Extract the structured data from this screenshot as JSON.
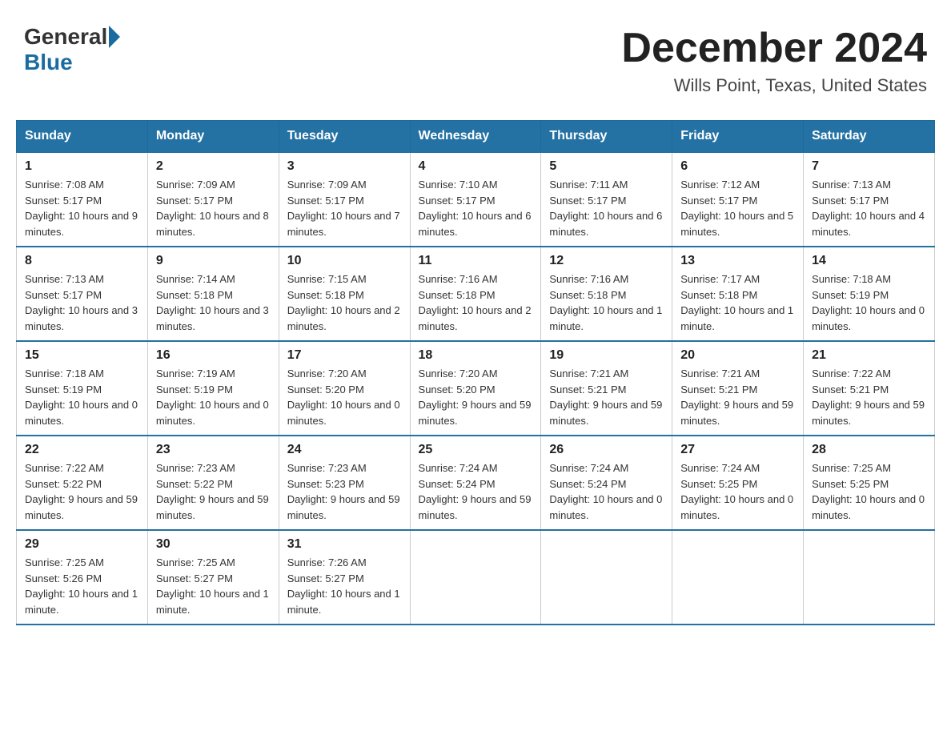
{
  "header": {
    "logo": {
      "general": "General",
      "blue": "Blue"
    },
    "title": "December 2024",
    "location": "Wills Point, Texas, United States"
  },
  "days_of_week": [
    "Sunday",
    "Monday",
    "Tuesday",
    "Wednesday",
    "Thursday",
    "Friday",
    "Saturday"
  ],
  "weeks": [
    [
      {
        "day": "1",
        "sunrise": "7:08 AM",
        "sunset": "5:17 PM",
        "daylight": "10 hours and 9 minutes."
      },
      {
        "day": "2",
        "sunrise": "7:09 AM",
        "sunset": "5:17 PM",
        "daylight": "10 hours and 8 minutes."
      },
      {
        "day": "3",
        "sunrise": "7:09 AM",
        "sunset": "5:17 PM",
        "daylight": "10 hours and 7 minutes."
      },
      {
        "day": "4",
        "sunrise": "7:10 AM",
        "sunset": "5:17 PM",
        "daylight": "10 hours and 6 minutes."
      },
      {
        "day": "5",
        "sunrise": "7:11 AM",
        "sunset": "5:17 PM",
        "daylight": "10 hours and 6 minutes."
      },
      {
        "day": "6",
        "sunrise": "7:12 AM",
        "sunset": "5:17 PM",
        "daylight": "10 hours and 5 minutes."
      },
      {
        "day": "7",
        "sunrise": "7:13 AM",
        "sunset": "5:17 PM",
        "daylight": "10 hours and 4 minutes."
      }
    ],
    [
      {
        "day": "8",
        "sunrise": "7:13 AM",
        "sunset": "5:17 PM",
        "daylight": "10 hours and 3 minutes."
      },
      {
        "day": "9",
        "sunrise": "7:14 AM",
        "sunset": "5:18 PM",
        "daylight": "10 hours and 3 minutes."
      },
      {
        "day": "10",
        "sunrise": "7:15 AM",
        "sunset": "5:18 PM",
        "daylight": "10 hours and 2 minutes."
      },
      {
        "day": "11",
        "sunrise": "7:16 AM",
        "sunset": "5:18 PM",
        "daylight": "10 hours and 2 minutes."
      },
      {
        "day": "12",
        "sunrise": "7:16 AM",
        "sunset": "5:18 PM",
        "daylight": "10 hours and 1 minute."
      },
      {
        "day": "13",
        "sunrise": "7:17 AM",
        "sunset": "5:18 PM",
        "daylight": "10 hours and 1 minute."
      },
      {
        "day": "14",
        "sunrise": "7:18 AM",
        "sunset": "5:19 PM",
        "daylight": "10 hours and 0 minutes."
      }
    ],
    [
      {
        "day": "15",
        "sunrise": "7:18 AM",
        "sunset": "5:19 PM",
        "daylight": "10 hours and 0 minutes."
      },
      {
        "day": "16",
        "sunrise": "7:19 AM",
        "sunset": "5:19 PM",
        "daylight": "10 hours and 0 minutes."
      },
      {
        "day": "17",
        "sunrise": "7:20 AM",
        "sunset": "5:20 PM",
        "daylight": "10 hours and 0 minutes."
      },
      {
        "day": "18",
        "sunrise": "7:20 AM",
        "sunset": "5:20 PM",
        "daylight": "9 hours and 59 minutes."
      },
      {
        "day": "19",
        "sunrise": "7:21 AM",
        "sunset": "5:21 PM",
        "daylight": "9 hours and 59 minutes."
      },
      {
        "day": "20",
        "sunrise": "7:21 AM",
        "sunset": "5:21 PM",
        "daylight": "9 hours and 59 minutes."
      },
      {
        "day": "21",
        "sunrise": "7:22 AM",
        "sunset": "5:21 PM",
        "daylight": "9 hours and 59 minutes."
      }
    ],
    [
      {
        "day": "22",
        "sunrise": "7:22 AM",
        "sunset": "5:22 PM",
        "daylight": "9 hours and 59 minutes."
      },
      {
        "day": "23",
        "sunrise": "7:23 AM",
        "sunset": "5:22 PM",
        "daylight": "9 hours and 59 minutes."
      },
      {
        "day": "24",
        "sunrise": "7:23 AM",
        "sunset": "5:23 PM",
        "daylight": "9 hours and 59 minutes."
      },
      {
        "day": "25",
        "sunrise": "7:24 AM",
        "sunset": "5:24 PM",
        "daylight": "9 hours and 59 minutes."
      },
      {
        "day": "26",
        "sunrise": "7:24 AM",
        "sunset": "5:24 PM",
        "daylight": "10 hours and 0 minutes."
      },
      {
        "day": "27",
        "sunrise": "7:24 AM",
        "sunset": "5:25 PM",
        "daylight": "10 hours and 0 minutes."
      },
      {
        "day": "28",
        "sunrise": "7:25 AM",
        "sunset": "5:25 PM",
        "daylight": "10 hours and 0 minutes."
      }
    ],
    [
      {
        "day": "29",
        "sunrise": "7:25 AM",
        "sunset": "5:26 PM",
        "daylight": "10 hours and 1 minute."
      },
      {
        "day": "30",
        "sunrise": "7:25 AM",
        "sunset": "5:27 PM",
        "daylight": "10 hours and 1 minute."
      },
      {
        "day": "31",
        "sunrise": "7:26 AM",
        "sunset": "5:27 PM",
        "daylight": "10 hours and 1 minute."
      },
      null,
      null,
      null,
      null
    ]
  ],
  "labels": {
    "sunrise_prefix": "Sunrise: ",
    "sunset_prefix": "Sunset: ",
    "daylight_prefix": "Daylight: "
  }
}
